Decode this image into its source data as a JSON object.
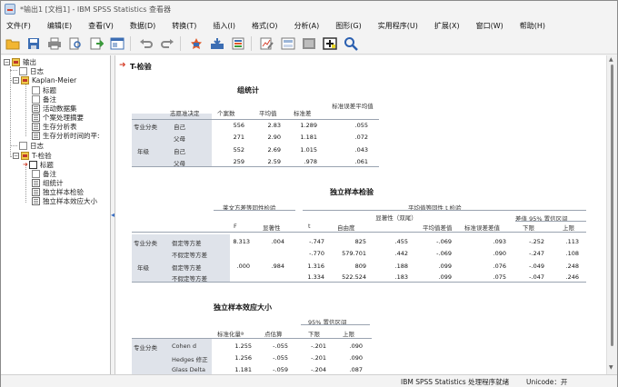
{
  "window": {
    "title": "*输出1 [文档1] - IBM SPSS Statistics 查看器"
  },
  "menu": [
    "文件(F)",
    "编辑(E)",
    "查看(V)",
    "数据(D)",
    "转换(T)",
    "插入(I)",
    "格式(O)",
    "分析(A)",
    "图形(G)",
    "实用程序(U)",
    "扩展(X)",
    "窗口(W)",
    "帮助(H)"
  ],
  "toolbar": [
    "open-folder-icon",
    "save-icon",
    "print-icon",
    "print-preview-icon",
    "export-icon",
    "dialog-recall-icon",
    "undo-icon",
    "redo-icon",
    "goto-data-icon",
    "goto-case-icon",
    "insert-variables-icon",
    "select-output-icon",
    "show-hide-icon",
    "designate-window-icon",
    "find-icon"
  ],
  "nav": {
    "items": [
      {
        "label": "输出",
        "level": 0
      },
      {
        "label": "日志",
        "level": 1
      },
      {
        "label": "Kaplan-Meier",
        "level": 1
      },
      {
        "label": "标题",
        "level": 2
      },
      {
        "label": "备注",
        "level": 2
      },
      {
        "label": "活动数据集",
        "level": 2
      },
      {
        "label": "个案处理摘要",
        "level": 2
      },
      {
        "label": "生存分析表",
        "level": 2
      },
      {
        "label": "生存分析时间的平:",
        "level": 2
      },
      {
        "label": "日志",
        "level": 1
      },
      {
        "label": "T-检验",
        "level": 1
      },
      {
        "label": "标题",
        "level": 2
      },
      {
        "label": "备注",
        "level": 2
      },
      {
        "label": "组统计",
        "level": 2
      },
      {
        "label": "独立样本检验",
        "level": 2
      },
      {
        "label": "独立样本效应大小",
        "level": 2
      }
    ]
  },
  "content": {
    "heading": "T-检验",
    "group_stats": {
      "title": "组统计",
      "headers": [
        "志愿准决定",
        "个案数",
        "平均值",
        "标准差",
        "标准误差平均值"
      ],
      "rows": [
        {
          "var": "专业分类",
          "group": "自己",
          "n": "556",
          "mean": "2.83",
          "sd": "1.289",
          "se": ".055"
        },
        {
          "var": "",
          "group": "父母",
          "n": "271",
          "mean": "2.90",
          "sd": "1.181",
          "se": ".072"
        },
        {
          "var": "年级",
          "group": "自己",
          "n": "552",
          "mean": "2.69",
          "sd": "1.015",
          "se": ".043"
        },
        {
          "var": "",
          "group": "父母",
          "n": "259",
          "mean": "2.59",
          "sd": ".978",
          "se": ".061"
        }
      ]
    },
    "indep_test": {
      "title": "独立样本检验",
      "levene_header": "莱文方差等同性检验",
      "ttest_header": "平均值等同性 t 检验",
      "ci_header": "差值 95% 置信区间",
      "cols": [
        "F",
        "显著性",
        "t",
        "自由度",
        "显著性（双尾）",
        "平均值差值",
        "标准误差差值",
        "下限",
        "上限"
      ],
      "rows": [
        {
          "var": "专业分类",
          "assume": "假定等方差",
          "F": "8.313",
          "sig": ".004",
          "t": "-.747",
          "df": "825",
          "sig2": ".455",
          "md": "-.069",
          "sed": ".093",
          "lo": "-.252",
          "hi": ".113"
        },
        {
          "var": "",
          "assume": "不假定等方差",
          "F": "",
          "sig": "",
          "t": "-.770",
          "df": "579.701",
          "sig2": ".442",
          "md": "-.069",
          "sed": ".090",
          "lo": "-.247",
          "hi": ".108"
        },
        {
          "var": "年级",
          "assume": "假定等方差",
          "F": ".000",
          "sig": ".984",
          "t": "1.316",
          "df": "809",
          "sig2": ".188",
          "md": ".099",
          "sed": ".076",
          "lo": "-.049",
          "hi": ".248"
        },
        {
          "var": "",
          "assume": "不假定等方差",
          "F": "",
          "sig": "",
          "t": "1.334",
          "df": "522.524",
          "sig2": ".183",
          "md": ".099",
          "sed": ".075",
          "lo": "-.047",
          "hi": ".246"
        }
      ]
    },
    "effect": {
      "title": "独立样本效应大小",
      "ci_header": "95% 置信区间",
      "cols": [
        "标准化量ª",
        "点估算",
        "下限",
        "上限"
      ],
      "rows": [
        {
          "var": "专业分类",
          "name": "Cohen d",
          "std": "1.255",
          "pe": "-.055",
          "lo": "-.201",
          "hi": ".090"
        },
        {
          "var": "",
          "name": "Hedges 修正",
          "std": "1.256",
          "pe": "-.055",
          "lo": "-.201",
          "hi": ".090"
        },
        {
          "var": "",
          "name": "Glass Delta",
          "std": "1.181",
          "pe": "-.059",
          "lo": "-.204",
          "hi": ".087"
        }
      ]
    }
  },
  "status": {
    "main": "IBM SPSS Statistics 处理程序就绪",
    "unicode": "Unicode：开"
  },
  "colors": {
    "accent": "#d6402b",
    "shade": "#dfe3ea"
  }
}
